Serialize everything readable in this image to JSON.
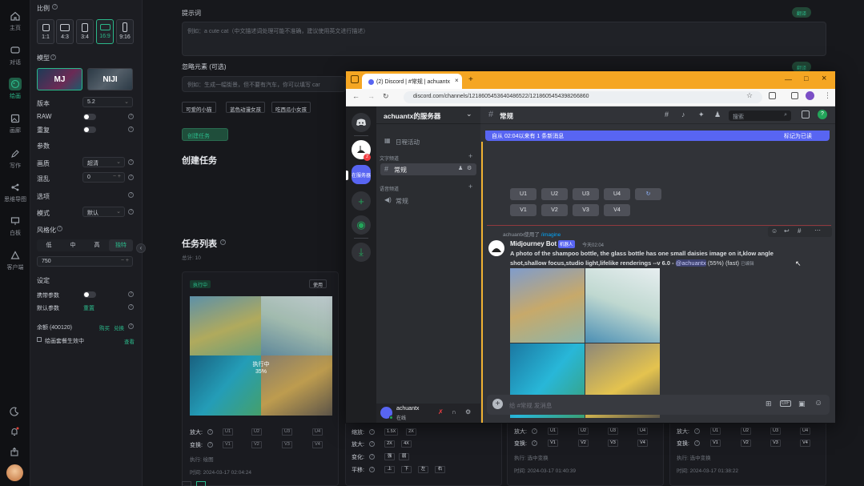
{
  "rail": {
    "items": [
      {
        "label": "主页",
        "icon": "home-icon"
      },
      {
        "label": "对话",
        "icon": "chat-icon"
      },
      {
        "label": "绘画",
        "icon": "palette-icon"
      },
      {
        "label": "画廊",
        "icon": "gallery-icon"
      },
      {
        "label": "写作",
        "icon": "pen-icon"
      },
      {
        "label": "思维导图",
        "icon": "mindmap-icon"
      },
      {
        "label": "白板",
        "icon": "whiteboard-icon"
      },
      {
        "label": "客户端",
        "icon": "client-icon"
      }
    ],
    "bottom_icons": [
      "moon-icon",
      "bell-icon",
      "share-icon",
      "avatar"
    ]
  },
  "panel": {
    "ratio_label": "比例",
    "ratios": [
      "1:1",
      "4:3",
      "3:4",
      "16:9",
      "9:16"
    ],
    "selected_ratio": "16:9",
    "model_label": "模型",
    "models": [
      "MJ",
      "NIJI"
    ],
    "version_label": "版本",
    "version_value": "5.2",
    "raw_label": "RAW",
    "repeat_label": "重复",
    "params_label": "参数",
    "quality_label": "画质",
    "quality_value": "超清",
    "chaos_label": "混乱",
    "chaos_value": "0",
    "style_section": "选项",
    "mode_label": "模式",
    "mode_value": "默认",
    "stylize_label": "风格化",
    "stylize_options": [
      "低",
      "中",
      "高",
      "独特"
    ],
    "stylize_value": "750",
    "settings_label": "设定",
    "carry_label": "携带参数",
    "default_label": "默认参数",
    "reset_label": "重置",
    "balance_label": "余额 (400120)",
    "recharge_label": "购买",
    "redeem_label": "兑换",
    "effective_label": "绘画套餐生效中",
    "view_label": "查看"
  },
  "main": {
    "prompt_label": "提示词",
    "prompt_placeholder": "例如：a cute cat（中文描述词处理可能不准确，建议使用英文进行描述）",
    "translate_btn": "翻译",
    "negative_label": "忽略元素 (可选)",
    "negative_placeholder": "例如：生成一幅街景，但不要有汽车，你可以填写 car",
    "translate_btn2": "翻译",
    "chips": [
      "可爱的小猫",
      "蓝色动漫女孩",
      "吃西瓜小女孩"
    ],
    "create_btn": "创建任务",
    "create_heading": "创建任务",
    "tasks_heading": "任务列表",
    "total_label": "总计: 10"
  },
  "card1": {
    "status": "执行中",
    "use_btn": "使用",
    "overlay_status": "执行中",
    "overlay_progress": "35%",
    "upscale_label": "放大:",
    "upscale_btns": [
      "U1",
      "U2",
      "U3",
      "U4"
    ],
    "vary_label": "变换:",
    "vary_btns": [
      "V1",
      "V2",
      "V3",
      "V4"
    ],
    "exec_label": "执行: 绘图",
    "time_label": "时间: 2024-03-17 02:04:24"
  },
  "card2": {
    "zoom_label": "缩放:",
    "zoom_btns": [
      "1.5X",
      "2X"
    ],
    "up_label": "放大:",
    "up_btns": [
      "2X",
      "4X"
    ],
    "change_label": "变化:",
    "change_btns": [
      "强",
      "弱"
    ],
    "pan_label": "平移:",
    "pan_btns": [
      "上",
      "下",
      "左",
      "右"
    ]
  },
  "card3": {
    "upscale_label": "放大:",
    "upscale_btns": [
      "U1",
      "U2",
      "U3",
      "U4"
    ],
    "vary_label": "变换:",
    "vary_btns": [
      "V1",
      "V2",
      "V3",
      "V4"
    ],
    "exec_label": "执行: 选中变换",
    "time_label": "时间: 2024-03-17 01:40:39"
  },
  "card4": {
    "upscale_label": "放大:",
    "upscale_btns": [
      "U1",
      "U2",
      "U3",
      "U4"
    ],
    "vary_label": "变换:",
    "vary_btns": [
      "V1",
      "V2",
      "V3",
      "V4"
    ],
    "exec_label": "执行: 选中变换",
    "time_label": "时间: 2024-03-17 01:38:22"
  },
  "browser": {
    "tab_title": "(2) Discord | #常规 | achuantx",
    "url": "discord.com/channels/1218605453640486522/1218605454398266860",
    "window_controls": [
      "minimize-icon",
      "maximize-icon",
      "close-icon"
    ]
  },
  "discord": {
    "server_name": "achuantx的服务器",
    "events": "日程活动",
    "text_category": "文字频道",
    "text_channel": "常规",
    "voice_category": "语音频道",
    "voice_channel": "常规",
    "guild_label": "在服务器",
    "user_name": "achuantx",
    "user_status": "在线",
    "channel_title": "常规",
    "search_placeholder": "搜索",
    "new_msg_banner": "自从 02:04以来有 1 条新消息",
    "mark_read": "标记为已读",
    "buttons_row1": [
      "U1",
      "U2",
      "U3",
      "U4"
    ],
    "buttons_row2": [
      "V1",
      "V2",
      "V3",
      "V4"
    ],
    "reply_user": "achuantx使用了",
    "reply_cmd": "/imagine",
    "bot_name": "Midjourney Bot",
    "bot_badge": "机器人",
    "bot_time": "今天02:04",
    "message": "A photo of the shampoo bottle, the glass bottle has one small daisies image on it,klow angle shot,shallow focus,studio light,lifelike renderings --v 6.0 - ",
    "mention": "@achuantx",
    "message_tail": " (55%) (fast)",
    "edited": "已编辑",
    "input_placeholder": "给 #常规 发消息"
  },
  "colors": {
    "accent": "#2bb88a",
    "discord_bg": "#313338",
    "discord_banner": "#5865f2",
    "chrome_orange": "#f5a623"
  }
}
